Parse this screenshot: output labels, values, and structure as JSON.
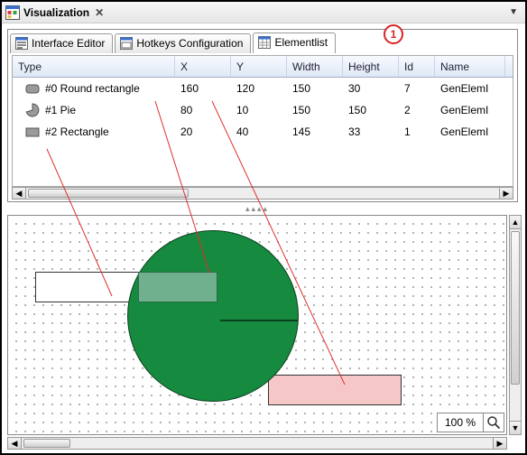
{
  "window": {
    "title": "Visualization",
    "callout": "1"
  },
  "tabs": [
    {
      "label": "Interface Editor"
    },
    {
      "label": "Hotkeys Configuration"
    },
    {
      "label": "Elementlist"
    }
  ],
  "columns": [
    "Type",
    "X",
    "Y",
    "Width",
    "Height",
    "Id",
    "Name"
  ],
  "rows": [
    {
      "type_label": "#0 Round rectangle",
      "x": "160",
      "y": "120",
      "w": "150",
      "h": "30",
      "id": "7",
      "name": "GenElemI"
    },
    {
      "type_label": "#1 Pie",
      "x": "80",
      "y": "10",
      "w": "150",
      "h": "150",
      "id": "2",
      "name": "GenElemI"
    },
    {
      "type_label": "#2 Rectangle",
      "x": "20",
      "y": "40",
      "w": "145",
      "h": "33",
      "id": "1",
      "name": "GenElemI"
    }
  ],
  "zoom": {
    "percent": "100 %"
  },
  "icons": {
    "round_rect": "round-rect-icon",
    "pie": "pie-icon",
    "rect": "rect-icon"
  },
  "colors": {
    "pie_fill": "#168a3f",
    "rect0_fill": "#71b08e",
    "rect2_fill": "#f5c7c7",
    "annotation": "#e03030"
  }
}
